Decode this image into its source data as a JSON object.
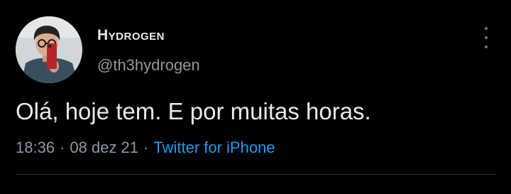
{
  "tweet": {
    "author_name": "Hydrogen",
    "author_handle": "@th3hydrogen",
    "text": "Olá, hoje tem. E por muitas horas.",
    "time": "18:36",
    "date": "08 dez 21",
    "separator": "·",
    "source": "Twitter for iPhone"
  },
  "icons": {
    "menu": "more-vertical-icon"
  },
  "colors": {
    "background": "#000000",
    "text_primary": "#e7e9ea",
    "text_secondary": "#8b98a5",
    "link": "#1d9bf0",
    "divider": "#2f3336"
  }
}
